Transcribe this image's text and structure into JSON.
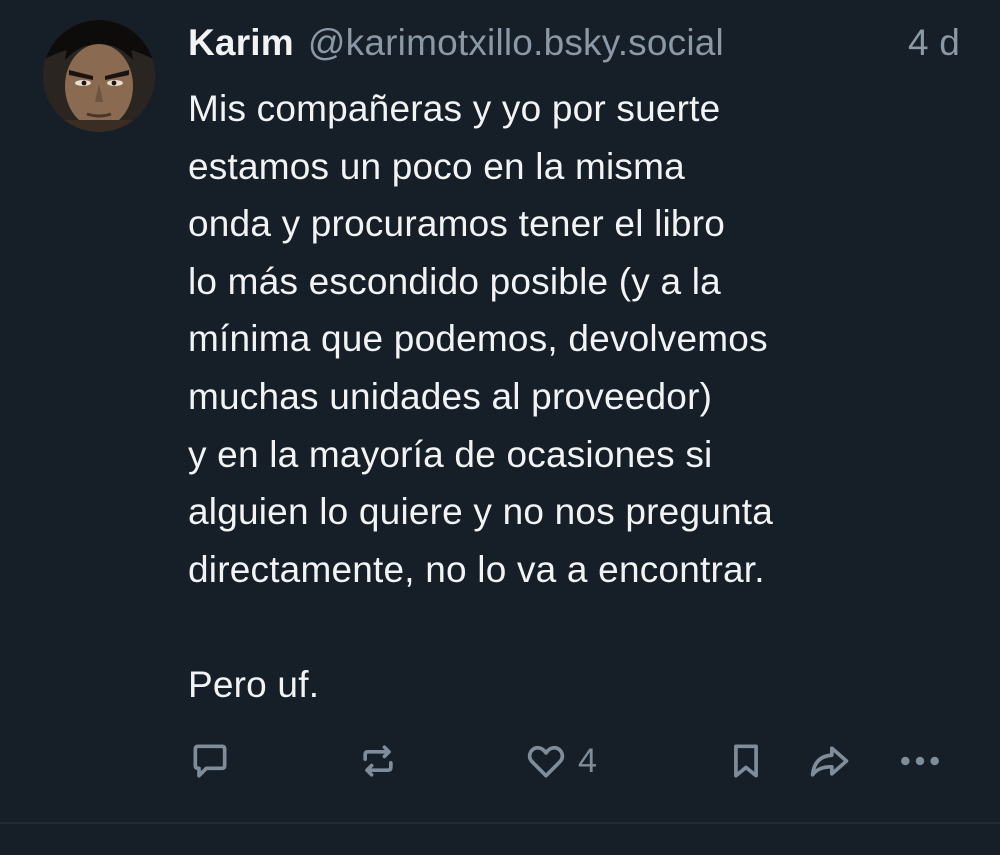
{
  "post": {
    "author_name": "Karim",
    "handle": "@karimotxillo.bsky.social",
    "timestamp": "4 d",
    "text": "Mis compañeras y yo por suerte\nestamos un poco en la misma\nonda y procuramos tener el libro\nlo más escondido posible (y a la\nmínima que podemos, devolvemos\nmuchas unidades al proveedor)\ny en la mayoría de ocasiones si\nalguien lo quiere y no nos pregunta\ndirectamente, no lo va a encontrar.\n\nPero uf.",
    "like_count": "4"
  },
  "actions": {
    "icons": [
      "reply-icon",
      "repost-icon",
      "like-icon",
      "bookmark-icon",
      "share-icon",
      "more-options-icon"
    ],
    "icon_color": "#7f8c9a"
  },
  "colors": {
    "background": "#161e27",
    "text": "#f1f3f5",
    "muted": "#8b98a5"
  }
}
